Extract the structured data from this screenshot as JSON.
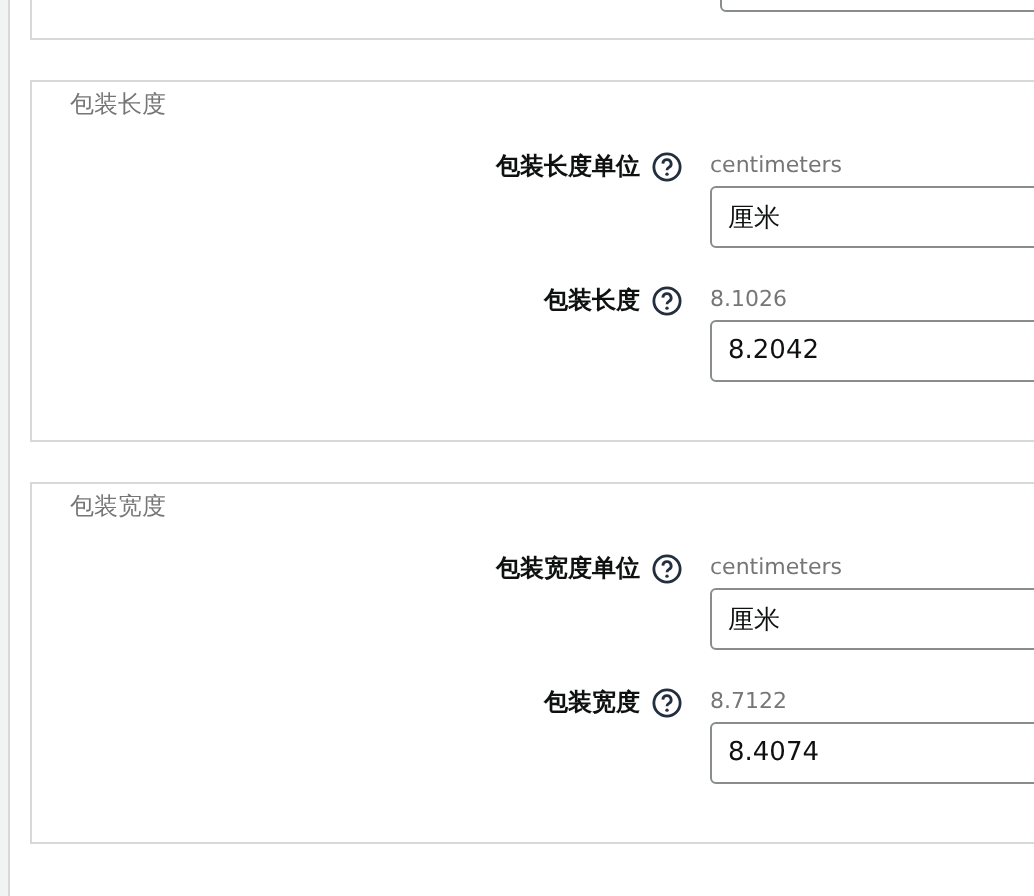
{
  "sections": [
    {
      "legend": "包装长度",
      "fields": [
        {
          "label": "包装长度单位",
          "hint": "centimeters",
          "value": "厘米"
        },
        {
          "label": "包装长度",
          "hint": "8.1026",
          "value": "8.2042"
        }
      ]
    },
    {
      "legend": "包装宽度",
      "fields": [
        {
          "label": "包装宽度单位",
          "hint": "centimeters",
          "value": "厘米"
        },
        {
          "label": "包装宽度",
          "hint": "8.7122",
          "value": "8.4074"
        }
      ]
    }
  ]
}
